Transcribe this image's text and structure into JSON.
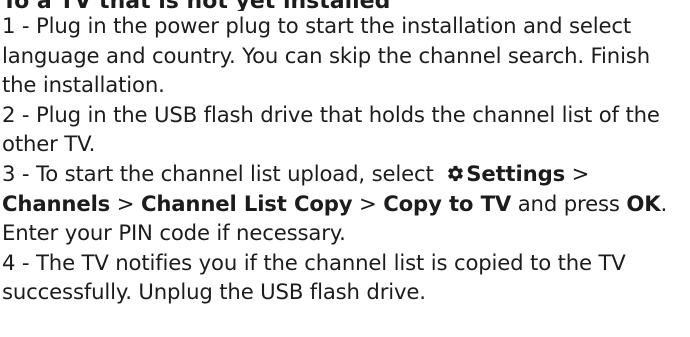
{
  "heading": "To a TV that is not yet installed",
  "steps": [
    {
      "number": "1 - ",
      "text": "Plug in the power plug to start the installation and select language and country. You can skip the channel search. Finish the installation."
    },
    {
      "number": "2 - ",
      "text": "Plug in the USB flash drive that holds the channel list of the other TV."
    },
    {
      "number": "3 - ",
      "text_before": "To start the channel list upload, select ",
      "settings_icon": "gear-icon",
      "settings_label": "Settings",
      "sep1": " > ",
      "channels_label": "Channels",
      "sep2": " > ",
      "channel_list_copy_label": "Channel List Copy",
      "sep3": " > ",
      "copy_to_tv_label": "Copy to TV",
      "text_middle": " and press ",
      "ok_label": "OK",
      "text_after": ". Enter your PIN code if necessary."
    },
    {
      "number": "4 - ",
      "text": "The TV notifies you if the channel list is copied to the TV successfully. Unplug the USB flash drive."
    }
  ]
}
